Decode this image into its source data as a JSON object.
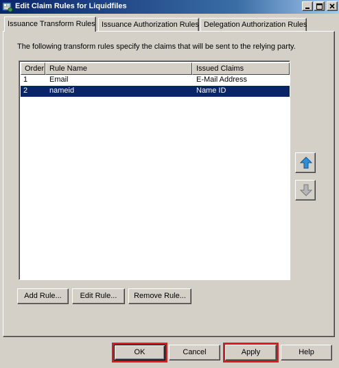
{
  "window": {
    "title": "Edit Claim Rules for Liquidfiles",
    "minimize_glyph": "_",
    "maximize_glyph": "□",
    "close_glyph": "×"
  },
  "tabs": [
    {
      "label": "Issuance Transform Rules",
      "active": true
    },
    {
      "label": "Issuance Authorization Rules",
      "active": false
    },
    {
      "label": "Delegation Authorization Rules",
      "active": false
    }
  ],
  "panel": {
    "description": "The following transform rules specify the claims that will be sent to the relying party."
  },
  "rules_table": {
    "columns": [
      "Order",
      "Rule Name",
      "Issued Claims"
    ],
    "rows": [
      {
        "order": "1",
        "name": "Email",
        "claims": "E-Mail Address",
        "selected": false
      },
      {
        "order": "2",
        "name": "nameid",
        "claims": "Name ID",
        "selected": true
      }
    ]
  },
  "side_buttons": {
    "move_up_icon": "arrow-up-icon",
    "move_down_icon": "arrow-down-icon"
  },
  "rule_buttons": {
    "add": "Add Rule...",
    "edit": "Edit Rule...",
    "remove": "Remove Rule..."
  },
  "dialog_buttons": {
    "ok": "OK",
    "cancel": "Cancel",
    "apply": "Apply",
    "help": "Help"
  },
  "colors": {
    "highlight": "#e8141c",
    "selection": "#0a246a",
    "arrow_up": "#2e8fd8",
    "arrow_disabled": "#9a9a9a"
  }
}
